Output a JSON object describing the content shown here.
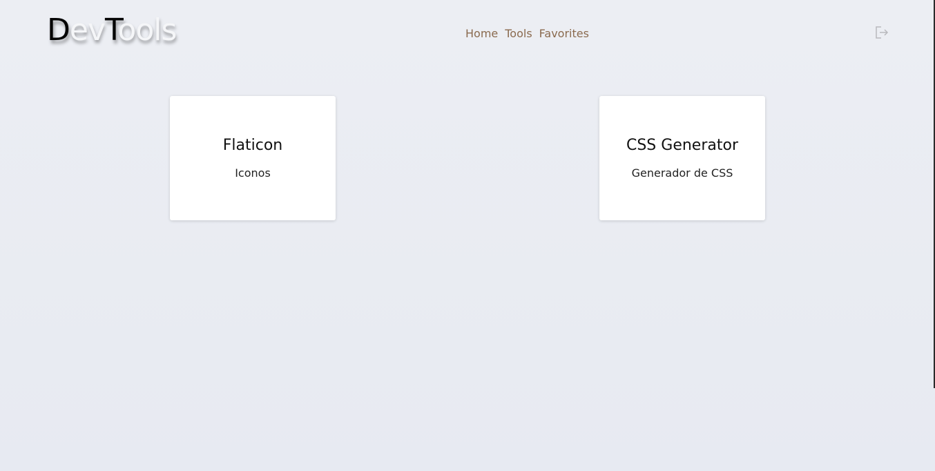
{
  "header": {
    "logo": {
      "l1": "D",
      "l2": "ev",
      "l3": "T",
      "l4": "ools"
    },
    "nav": [
      {
        "label": "Home"
      },
      {
        "label": "Tools"
      },
      {
        "label": "Favorites"
      }
    ],
    "logout_icon": "logout-icon"
  },
  "cards": [
    {
      "title": "Flaticon",
      "description": "Iconos"
    },
    {
      "title": "CSS Generator",
      "description": "Generador de CSS"
    }
  ],
  "colors": {
    "background": "#eceef3",
    "nav_link": "#8a6a4e",
    "card": "#ffffff",
    "logo_dark": "#050505",
    "logo_light": "#f5f6f8"
  }
}
